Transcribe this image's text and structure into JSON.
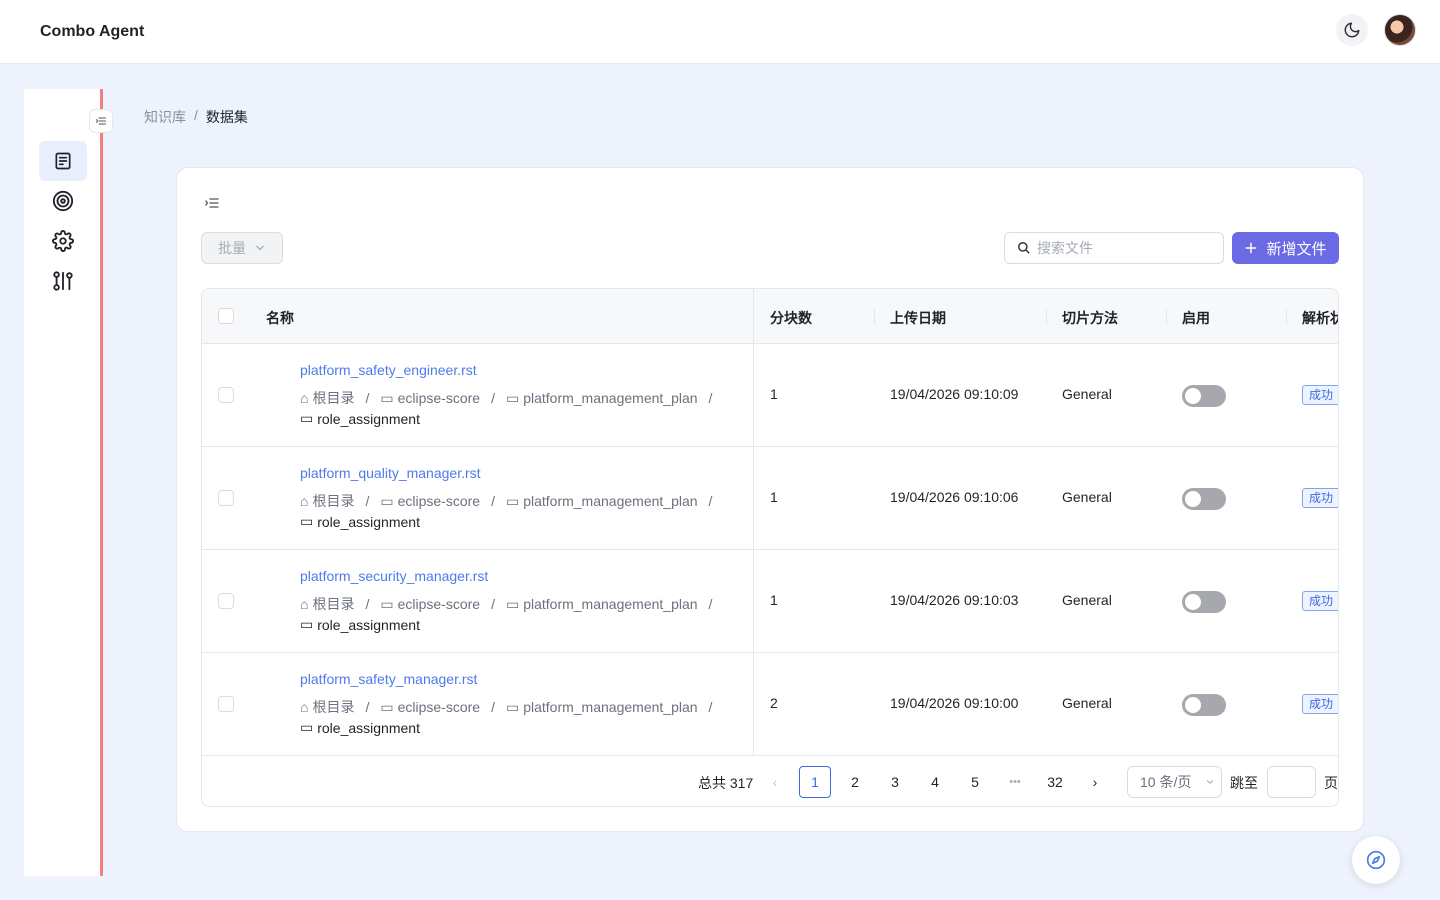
{
  "app": {
    "title": "Combo Agent"
  },
  "breadcrumb": {
    "parent": "知识库",
    "separator": "/",
    "current": "数据集"
  },
  "toolbar": {
    "batch_label": "批量",
    "search_placeholder": "搜索文件",
    "add_label": "新增文件"
  },
  "table": {
    "columns": [
      "名称",
      "分块数",
      "上传日期",
      "切片方法",
      "启用",
      "解析状"
    ],
    "rows": [
      {
        "name": "platform_safety_engineer.rst",
        "path": [
          "根目录",
          "eclipse-score",
          "platform_management_plan",
          "role_assignment"
        ],
        "chunks": "1",
        "date": "19/04/2026 09:10:09",
        "method": "General",
        "status": "成功"
      },
      {
        "name": "platform_quality_manager.rst",
        "path": [
          "根目录",
          "eclipse-score",
          "platform_management_plan",
          "role_assignment"
        ],
        "chunks": "1",
        "date": "19/04/2026 09:10:06",
        "method": "General",
        "status": "成功"
      },
      {
        "name": "platform_security_manager.rst",
        "path": [
          "根目录",
          "eclipse-score",
          "platform_management_plan",
          "role_assignment"
        ],
        "chunks": "1",
        "date": "19/04/2026 09:10:03",
        "method": "General",
        "status": "成功"
      },
      {
        "name": "platform_safety_manager.rst",
        "path": [
          "根目录",
          "eclipse-score",
          "platform_management_plan",
          "role_assignment"
        ],
        "chunks": "2",
        "date": "19/04/2026 09:10:00",
        "method": "General",
        "status": "成功"
      }
    ]
  },
  "pagination": {
    "total_label": "总共 317",
    "pages": [
      "1",
      "2",
      "3",
      "4",
      "5"
    ],
    "ellipsis": "•••",
    "last_page": "32",
    "page_size": "10 条/页",
    "jump_label": "跳至",
    "jump_suffix": "页"
  },
  "colors": {
    "primary": "#6b6ae5",
    "link": "#4e7bea",
    "sidebar_accent": "#f47c83",
    "background": "#eef3fd"
  }
}
